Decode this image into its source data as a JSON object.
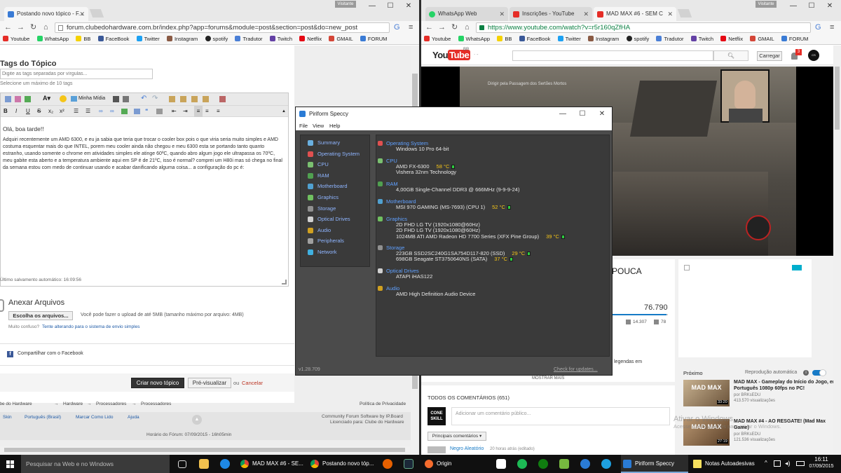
{
  "left_browser": {
    "user_badge": "Visitante",
    "tabs": [
      {
        "label": "Postando novo tópico - F..."
      }
    ],
    "url": "forum.clubedohardware.com.br/index.php?app=forums&module=post&section=post&do=new_post",
    "bookmarks": [
      "Youtube",
      "WhatsApp",
      "BB",
      "FaceBook",
      "Twitter",
      "Instagram",
      "spotify",
      "Tradutor",
      "Twitch",
      "Netflix",
      "GMAIL",
      "FORUM"
    ],
    "tags_title": "Tags do Tópico",
    "tags_placeholder": "Digite as tags separadas por vírgulas...",
    "tags_hint": "Selecione um máximo de 10 tags",
    "editor_source_label": "Minha Mídia",
    "editor_text": {
      "greeting": "Olá, boa tarde!!",
      "body": "Adquiri recentemente um AMD 6300, e eu ja sabia que teria que trocar o cooler box pois o que viria seria muito simples e AMD costuma esquentar mais do que INTEL, porem meu cooler ainda não chegou e meu 6300 esta se portando tanto quanto estranho, usando somente o chrome em atividades simples ele atinge 60ºC, quando abro algum jogo ele ultrapassa os 70ºC, meu gabite esta aberto e a temperatura ambiente aqui em SP é de 21ºC, isso é normal? comprei um H80i mas só chega no final da semana estou com medo de continuar usando e acabar danificando alguma coisa... a configuração do pc é:"
    },
    "autosave": "Último salvamento automático: 16:09:56",
    "attach_title": "Anexar Arquivos",
    "choose_files": "Escolha os arquivos...",
    "upload_info": "Você pode fazer o upload de até 5MB (tamanho máximo por arquivo: 4MB)",
    "upload_confused": "Muito confuso?",
    "upload_alt_link": "Tente alterando para o sistema de envio simples",
    "share_facebook": "Compartilhar com o Facebook",
    "create_topic": "Criar novo tópico",
    "preview": "Pré-visualizar",
    "or_label": "ou",
    "cancel": "Cancelar",
    "breadcrumb": [
      "Fórum do Clube do Hardware",
      "Hardware",
      "Processadores",
      "Processadores"
    ],
    "privacy": "Política de Privacidade",
    "footer_links": [
      "Skin",
      "Português (Brasil)",
      "Marcar Como Lido",
      "Ajuda"
    ],
    "credits_1": "Community Forum Software by IP.Board",
    "credits_2": "Licenciado para: Clube do Hardware",
    "forum_time": "Horário do Fórum: 07/09/2015 - 16h05min"
  },
  "right_browser": {
    "user_badge": "Visitante",
    "tabs": [
      {
        "label": "WhatsApp Web"
      },
      {
        "label": "Inscrições - YouTube"
      },
      {
        "label": "MAD MAX #6 - SEM C"
      }
    ],
    "url": "https://www.youtube.com/watch?v=r5r160qZfHA",
    "youtube_region": "BR",
    "upload_button": "Carregar",
    "notif_count": "3",
    "video_title_fragment": "POUCA",
    "game_hint": "Dirigir pela Passagem dos Sertões Mortos",
    "views": "76.790",
    "likes": "14.307",
    "dislikes": "78",
    "description_fragment": "legendas em",
    "show_more": "MOSTRAR MAIS",
    "comments_header": "TODOS OS COMENTÁRIOS",
    "comments_count": "(651)",
    "channel_avatar": "CONE SKILL",
    "comment_placeholder": "Adicionar um comentário público...",
    "sort_label": "Principais comentários",
    "first_commenter": "Negro Aleatório",
    "first_comment_meta": "20 horas atrás (editado)",
    "next_label": "Próximo",
    "autoplay_label": "Reprodução automática",
    "related": [
      {
        "title": "MAD MAX - Gameplay do Início do Jogo, em Português 1080p 60fps no PC!",
        "channel": "por BRKsEDU",
        "views": "413.570 visualizações",
        "duration": "33:20",
        "thumb_text": "MAD MAX"
      },
      {
        "title": "MAD MAX #4 - AO RESGATE! (Mad Max Game)",
        "channel": "por BRKsEDU",
        "views": "121.536 visualizações",
        "duration": "27:19",
        "thumb_text": "MAD MAX"
      }
    ],
    "activation_title": "Ativar o Windows",
    "activation_sub": "Acesse Configurações para ativar o Windows."
  },
  "speccy": {
    "title": "Piriform Speccy",
    "menu": [
      "File",
      "View",
      "Help"
    ],
    "nav": [
      "Summary",
      "Operating System",
      "CPU",
      "RAM",
      "Motherboard",
      "Graphics",
      "Storage",
      "Optical Drives",
      "Audio",
      "Peripherals",
      "Network"
    ],
    "nav_colors": [
      "#6ab0e0",
      "#e05050",
      "#7ac070",
      "#50a050",
      "#50a0d0",
      "#70c060",
      "#909090",
      "#d0d0d0",
      "#d0a020",
      "#a0a0a0",
      "#40b0e0"
    ],
    "sections": [
      {
        "name": "Operating System",
        "color": "#e05050",
        "lines": [
          "Windows 10 Pro 64-bit"
        ],
        "temps": []
      },
      {
        "name": "CPU",
        "color": "#7ac070",
        "lines": [
          "AMD FX-6300",
          "Vishera 32nm Technology"
        ],
        "temps": [
          "58 °C"
        ]
      },
      {
        "name": "RAM",
        "color": "#50a050",
        "lines": [
          "4,00GB Single-Channel DDR3 @ 666MHz (9-9-9-24)"
        ],
        "temps": []
      },
      {
        "name": "Motherboard",
        "color": "#50a0d0",
        "lines": [
          "MSI 970 GAMING (MS-7693) (CPU 1)"
        ],
        "temps": [
          "52 °C"
        ]
      },
      {
        "name": "Graphics",
        "color": "#70c060",
        "lines": [
          "2D FHD LG TV (1920x1080@60Hz)",
          "2D FHD LG TV (1920x1080@60Hz)",
          "1024MB ATI AMD Radeon HD 7700 Series (XFX Pine Group)"
        ],
        "temps": [
          "39 °C"
        ]
      },
      {
        "name": "Storage",
        "color": "#909090",
        "lines": [
          "223GB SSD2SC240G1SA754D117-820 (SSD)",
          "698GB Seagate ST3750640NS (SATA)"
        ],
        "temps": [
          "29 °C",
          "37 °C"
        ]
      },
      {
        "name": "Optical Drives",
        "color": "#d0d0d0",
        "lines": [
          "ATAPI iHAS122"
        ],
        "temps": []
      },
      {
        "name": "Audio",
        "color": "#d0a020",
        "lines": [
          "AMD High Definition Audio Device"
        ],
        "temps": []
      }
    ],
    "version": "v1.28.709",
    "check_updates": "Check for updates..."
  },
  "taskbar": {
    "search_placeholder": "Pesquisar na Web e no Windows",
    "apps": [
      "MAD MAX #6 - SE...",
      "Postando novo tóp...",
      "Origin",
      "Piriform Speccy",
      "Notas Autoadesivas"
    ],
    "time": "16:11",
    "date": "07/09/2015"
  }
}
